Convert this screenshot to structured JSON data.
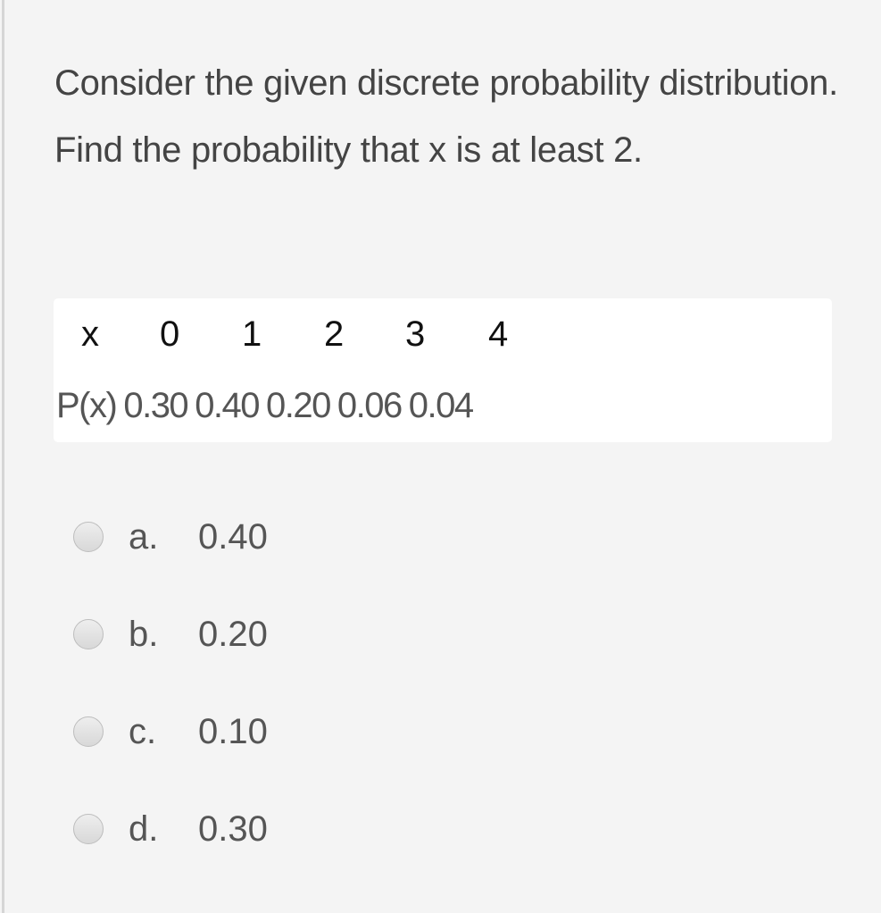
{
  "question": "Consider the given discrete probability distribution. Find the probability that x is at least 2.",
  "table": {
    "header": [
      "x",
      "0",
      "1",
      "2",
      "3",
      "4"
    ],
    "probabilities": [
      "P(x)",
      "0.30",
      "0.40",
      "0.20",
      "0.06",
      "0.04"
    ]
  },
  "options": [
    {
      "letter": "a.",
      "value": "0.40"
    },
    {
      "letter": "b.",
      "value": "0.20"
    },
    {
      "letter": "c.",
      "value": "0.10"
    },
    {
      "letter": "d.",
      "value": "0.30"
    }
  ]
}
